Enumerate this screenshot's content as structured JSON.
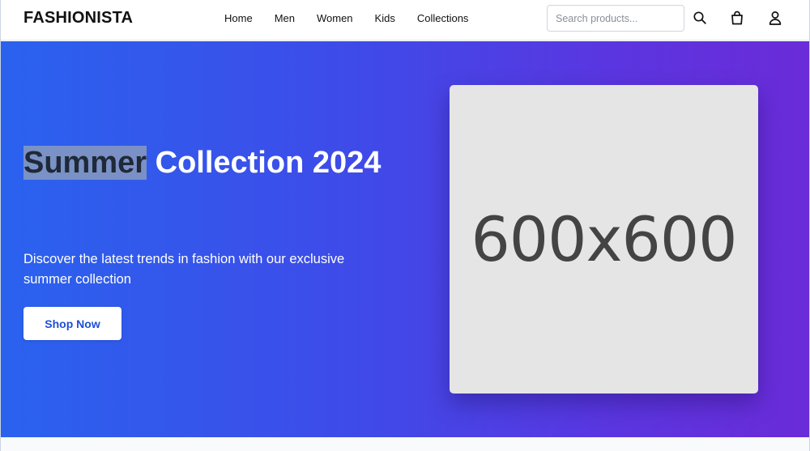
{
  "header": {
    "logo": "FASHIONISTA",
    "nav": [
      {
        "label": "Home"
      },
      {
        "label": "Men"
      },
      {
        "label": "Women"
      },
      {
        "label": "Kids"
      },
      {
        "label": "Collections"
      }
    ],
    "search": {
      "placeholder": "Search products...",
      "value": ""
    },
    "icons": [
      "search-icon",
      "shopping-bag-icon",
      "user-icon"
    ]
  },
  "hero": {
    "title_highlighted": "Summer",
    "title_rest": " Collection 2024",
    "subtitle": "Discover the latest trends in fashion with our exclusive summer collection",
    "cta_label": "Shop Now",
    "image_placeholder": "600x600"
  },
  "colors": {
    "gradient_start": "#2a62ee",
    "gradient_end": "#6b2bd8",
    "cta_text": "#1d4ed8",
    "selection_highlight": "#94a3b8"
  }
}
